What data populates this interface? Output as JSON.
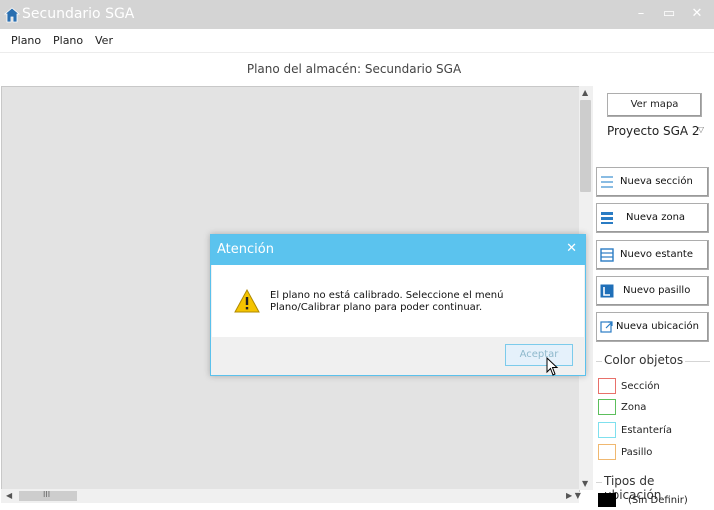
{
  "window": {
    "title": "Secundario SGA",
    "minimize": "–",
    "maximize": "▭",
    "close": "✕"
  },
  "menu": {
    "items": [
      "Plano",
      "Plano",
      "Ver"
    ]
  },
  "plan": {
    "header": "Plano del almacén: Secundario SGA"
  },
  "scroll": {
    "grip": "III"
  },
  "sidebar": {
    "ver_mapa": "Ver mapa",
    "project": "Proyecto SGA 2",
    "buttons": [
      {
        "label": "Nueva sección",
        "icon": "lines-icon"
      },
      {
        "label": "Nueva zona",
        "icon": "zone-icon"
      },
      {
        "label": "Nuevo estante",
        "icon": "shelf-icon"
      },
      {
        "label": "Nuevo pasillo",
        "icon": "aisle-icon"
      },
      {
        "label": "Nueva ubicación",
        "icon": "location-icon"
      }
    ],
    "color_group": {
      "legend": "Color objetos",
      "items": [
        {
          "label": "Sección",
          "color": "#e8706a"
        },
        {
          "label": "Zona",
          "color": "#5cbf5c"
        },
        {
          "label": "Estantería",
          "color": "#7fe0ee"
        },
        {
          "label": "Pasillo",
          "color": "#f0b870"
        }
      ]
    },
    "types_group": {
      "legend": "Tipos de ubicación",
      "items": [
        {
          "label": "(Sin Definir)",
          "color": "#000000"
        }
      ]
    }
  },
  "dialog": {
    "title": "Atención",
    "close": "✕",
    "message": "El plano no está calibrado. Seleccione el menú Plano/Calibrar plano para poder continuar.",
    "ok": "Aceptar"
  },
  "colors": {
    "accent": "#5bc3ee",
    "titlebar": "#d4d4d4",
    "canvas": "#e3e3e3"
  }
}
